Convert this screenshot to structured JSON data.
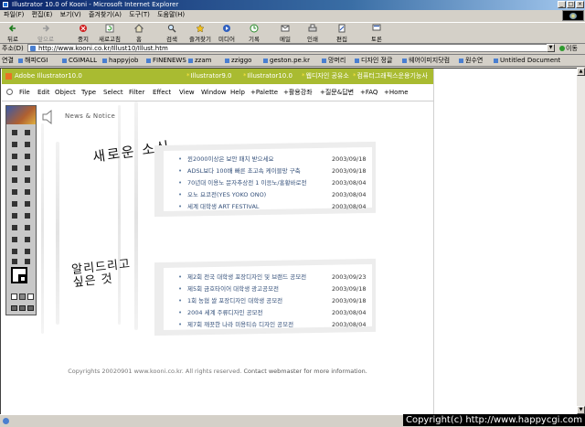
{
  "window": {
    "title": "Illustrator 10.0 of Kooni - Microsoft Internet Explorer"
  },
  "menubar": [
    "파일(F)",
    "편집(E)",
    "보기(V)",
    "즐겨찾기(A)",
    "도구(T)",
    "도움말(H)"
  ],
  "toolbar": {
    "buttons": [
      "뒤로",
      "앞으로",
      "중지",
      "새로고침",
      "홈",
      "검색",
      "즐겨찾기",
      "미디어",
      "기록",
      "메일",
      "인쇄",
      "편집",
      "토론"
    ]
  },
  "addressbar": {
    "label": "주소(D)",
    "url": "http://www.kooni.co.kr/Illust10/Illust.htm",
    "go_label": "이동"
  },
  "linksbar": {
    "label": "연결",
    "items": [
      "해피CGI",
      "CGIMALL",
      "happyjob",
      "FINENEWS",
      "zzam",
      "zziggo",
      "geston.pe.kr",
      "망머리",
      "디자인 정글",
      "웨어이미지닷컴",
      "원수연",
      "Untitled Document"
    ]
  },
  "site": {
    "top_nav": [
      "Adobe Illustrator10.0",
      "Illustrator9.0",
      "Illustrator10.0",
      "웹디자인 공유소",
      "컴퓨터그래픽스운용기능사"
    ],
    "menu": [
      "File",
      "Edit",
      "Object",
      "Type",
      "Select",
      "Filter",
      "Effect",
      "View",
      "Window",
      "Help",
      "+Palette",
      "+활용강좌",
      "+질문&답변",
      "+FAQ",
      "+Home"
    ],
    "news_heading": "News & Notice",
    "section1_calligraphy": "새로운 소식",
    "section2_calligraphy": "알리드리고 싶은 것",
    "news_items": [
      {
        "title": "윈2000이상은 보안 패치 받으세요",
        "date": "2003/09/18"
      },
      {
        "title": "ADSL보다 100배 빠른 초고속 케이블망 구축",
        "date": "2003/09/18"
      },
      {
        "title": "70년대 이용노 문자추상전 1 이응노/홍황바로전",
        "date": "2003/08/04"
      },
      {
        "title": "오노 요코전(YES YOKO ONO)",
        "date": "2003/08/04"
      },
      {
        "title": "세계 대학생 ART FESTIVAL",
        "date": "2003/08/04"
      }
    ],
    "notice_items": [
      {
        "title": "제2회 전국 대학생 포장디자인 및 브랜드 공모전",
        "date": "2003/09/23"
      },
      {
        "title": "제5회 금호타이어 대학생 광고공모전",
        "date": "2003/09/18"
      },
      {
        "title": "1회 농협 쌀 포장디자인 대학생 공모전",
        "date": "2003/09/18"
      },
      {
        "title": "2004 세계 주류디자인 공모전",
        "date": "2003/08/04"
      },
      {
        "title": "제7회 깨끗한 나라 미용티슈 디자인 공모전",
        "date": "2003/08/04"
      }
    ],
    "copyright": "Copyrights 20020901 www.kooni.co.kr. All rights reserved.",
    "contact": "Contact webmaster for more information."
  },
  "watermark": "Copyright(c) http://www.happycgi.com",
  "colors": {
    "titlebar": "#0a246a",
    "site_bar": "#a9bb31",
    "link_text": "#34507a"
  }
}
